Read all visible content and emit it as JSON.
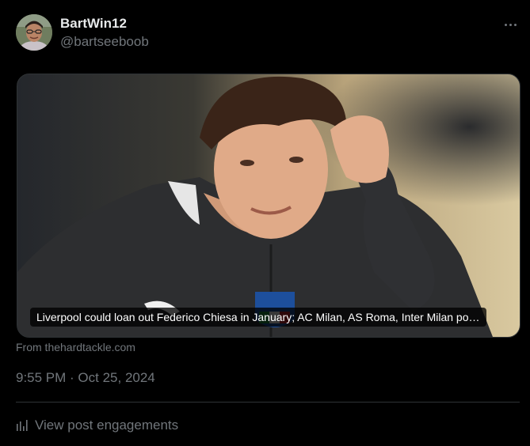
{
  "post": {
    "author": {
      "display_name": "BartWin12",
      "handle": "@bartseeboob",
      "avatar_icon": "user-avatar"
    },
    "more_icon": "ellipsis-icon",
    "link_card": {
      "image_alt": "player-photo",
      "title": "Liverpool could loan out Federico Chiesa in January; AC Milan, AS Roma, Inter Milan po…",
      "source": "From thehardtackle.com"
    },
    "timestamp": "9:55 PM · Oct 25, 2024",
    "engagements": {
      "icon": "bar-chart-icon",
      "label": "View post engagements"
    }
  },
  "colors": {
    "background": "#000000",
    "primary_text": "#e7e9ea",
    "secondary_text": "#71767b",
    "border": "#2f3336"
  }
}
